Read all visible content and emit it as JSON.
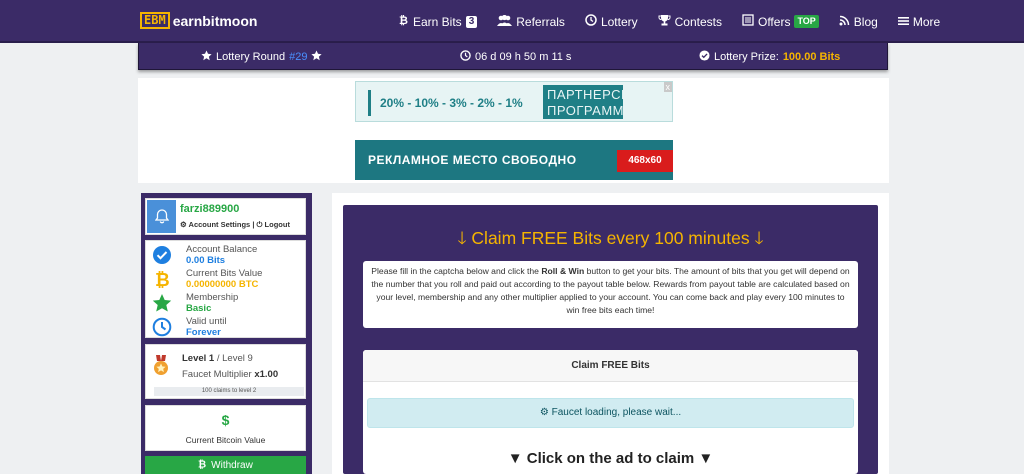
{
  "brand": {
    "mark": "EBM",
    "name": "earnbitmoon"
  },
  "nav": {
    "earn_bits": "Earn Bits",
    "earn_bits_count": "3",
    "referrals": "Referrals",
    "lottery": "Lottery",
    "contests": "Contests",
    "offers": "Offers",
    "offers_badge": "TOP",
    "blog": "Blog",
    "more": "More"
  },
  "lottery_bar": {
    "round_label": "Lottery Round",
    "round_number": "#29",
    "timer": "06 d 09 h 50 m 11 s",
    "prize_label": "Lottery Prize:",
    "prize_value": "100.00 Bits"
  },
  "ads": {
    "banner1_text": "20% - 10% - 3% - 2% - 1%",
    "banner1_tag": "ПАРТНЕРСКАЯ ПРОГРАММА",
    "banner1_close": "x",
    "banner2_text": "РЕКЛАМНОЕ МЕСТО СВОБОДНО",
    "banner2_size": "468x60"
  },
  "sidebar": {
    "username": "farzi889900",
    "account_settings": "Account Settings",
    "separator": "|",
    "logout": "Logout",
    "stats": [
      {
        "label": "Account Balance",
        "value": "0.00 Bits",
        "icon": "check-circle-icon",
        "color": "#1e7fe0"
      },
      {
        "label": "Current Bits Value",
        "value": "0.00000000 BTC",
        "icon": "bitcoin-icon",
        "color": "#f5b400"
      },
      {
        "label": "Membership",
        "value": "Basic",
        "icon": "star-icon",
        "color": "#28a745"
      },
      {
        "label": "Valid until",
        "value": "Forever",
        "icon": "clock-icon",
        "color": "#1e7fe0"
      }
    ],
    "level_label": "Level 1",
    "level_max": "/ Level 9",
    "multiplier_label": "Faucet Multiplier",
    "multiplier_value": "x1.00",
    "progress_text": "100 claims to level 2",
    "btc_symbol": "$",
    "btc_label": "Current Bitcoin Value",
    "withdraw": "Withdraw"
  },
  "main": {
    "title": "Claim FREE Bits every 100 minutes",
    "desc_part1": "Please fill in the captcha below and click the ",
    "desc_bold": "Roll & Win",
    "desc_part2": " button to get your bits. The amount of bits that you get will depend on the number that you roll and paid out according to the payout table below. Rewards from payout table are calculated based on your level, membership and any other multiplier applied to your account. You can come back and play every 100 minutes to win free bits each time!",
    "claim_header": "Claim FREE Bits",
    "loading": "Faucet loading, please wait...",
    "ad_click": "▼ Click on the ad to claim ▼"
  },
  "colors": {
    "purple": "#3b2b67",
    "gold": "#f5b400",
    "green": "#28a745",
    "blue": "#4a90ff"
  }
}
